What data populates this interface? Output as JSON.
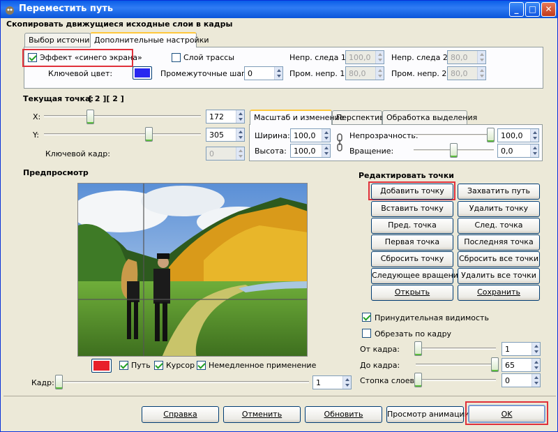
{
  "window": {
    "title": "Переместить путь"
  },
  "section_header": "Скопировать движущиеся исходные слои в кадры",
  "tabs_top": [
    "Выбор источника",
    "Дополнительные настройки"
  ],
  "adv": {
    "bluebox_label": "Эффект «синего экрана»",
    "trace_layer_label": "Слой трассы",
    "keycolor_label": "Ключевой цвет:",
    "keycolor": "#2828f0",
    "tween_label": "Промежуточные шаги:",
    "tween_value": "0",
    "trace1_label": "Непр. следа 1:",
    "trace1_value": "100,0",
    "trace2_label": "Непр. следа 2:",
    "trace2_value": "80,0",
    "tween1_label": "Пром. непр. 1:",
    "tween1_value": "80,0",
    "tween2_label": "Пром. непр. 2:",
    "tween2_value": "80,0"
  },
  "point": {
    "label": "Текущая точка:",
    "index": "[ 2 ][ 2 ]",
    "x_label": "X:",
    "x_value": "172",
    "y_label": "Y:",
    "y_value": "305",
    "keyframe_label": "Ключевой кадр:",
    "keyframe_value": "0"
  },
  "tabs_mid": [
    "Масштаб и изменение",
    "Перспектива",
    "Обработка выделения"
  ],
  "scale": {
    "width_label": "Ширина:",
    "width_value": "100,0",
    "height_label": "Высота:",
    "height_value": "100,0",
    "opacity_label": "Непрозрачность:",
    "opacity_value": "100,0",
    "rotation_label": "Вращение:",
    "rotation_value": "0,0"
  },
  "preview": {
    "label": "Предпросмотр",
    "line_color": "#e8202a",
    "path_label": "Путь",
    "cursor_label": "Курсор",
    "instant_label": "Немедленное применение",
    "frame_label": "Кадр:",
    "frame_value": "1"
  },
  "edit": {
    "header": "Редактировать точки",
    "buttons": [
      "Добавить точку",
      "Захватить путь",
      "Вставить точку",
      "Удалить точку",
      "Пред. точка",
      "След. точка",
      "Первая точка",
      "Последняя точка",
      "Сбросить точку",
      "Сбросить все точки",
      "Следующее вращение",
      "Удалить все точки",
      "Открыть",
      "Сохранить"
    ],
    "force_visibility_label": "Принудительная видимость",
    "clip_label": "Обрезать по кадру",
    "from_label": "От кадра:",
    "from_value": "1",
    "to_label": "До кадра:",
    "to_value": "65",
    "stack_label": "Стопка слоев:",
    "stack_value": "0"
  },
  "footer": [
    "Справка",
    "Отменить",
    "Обновить",
    "Просмотр анимации",
    "OK"
  ]
}
